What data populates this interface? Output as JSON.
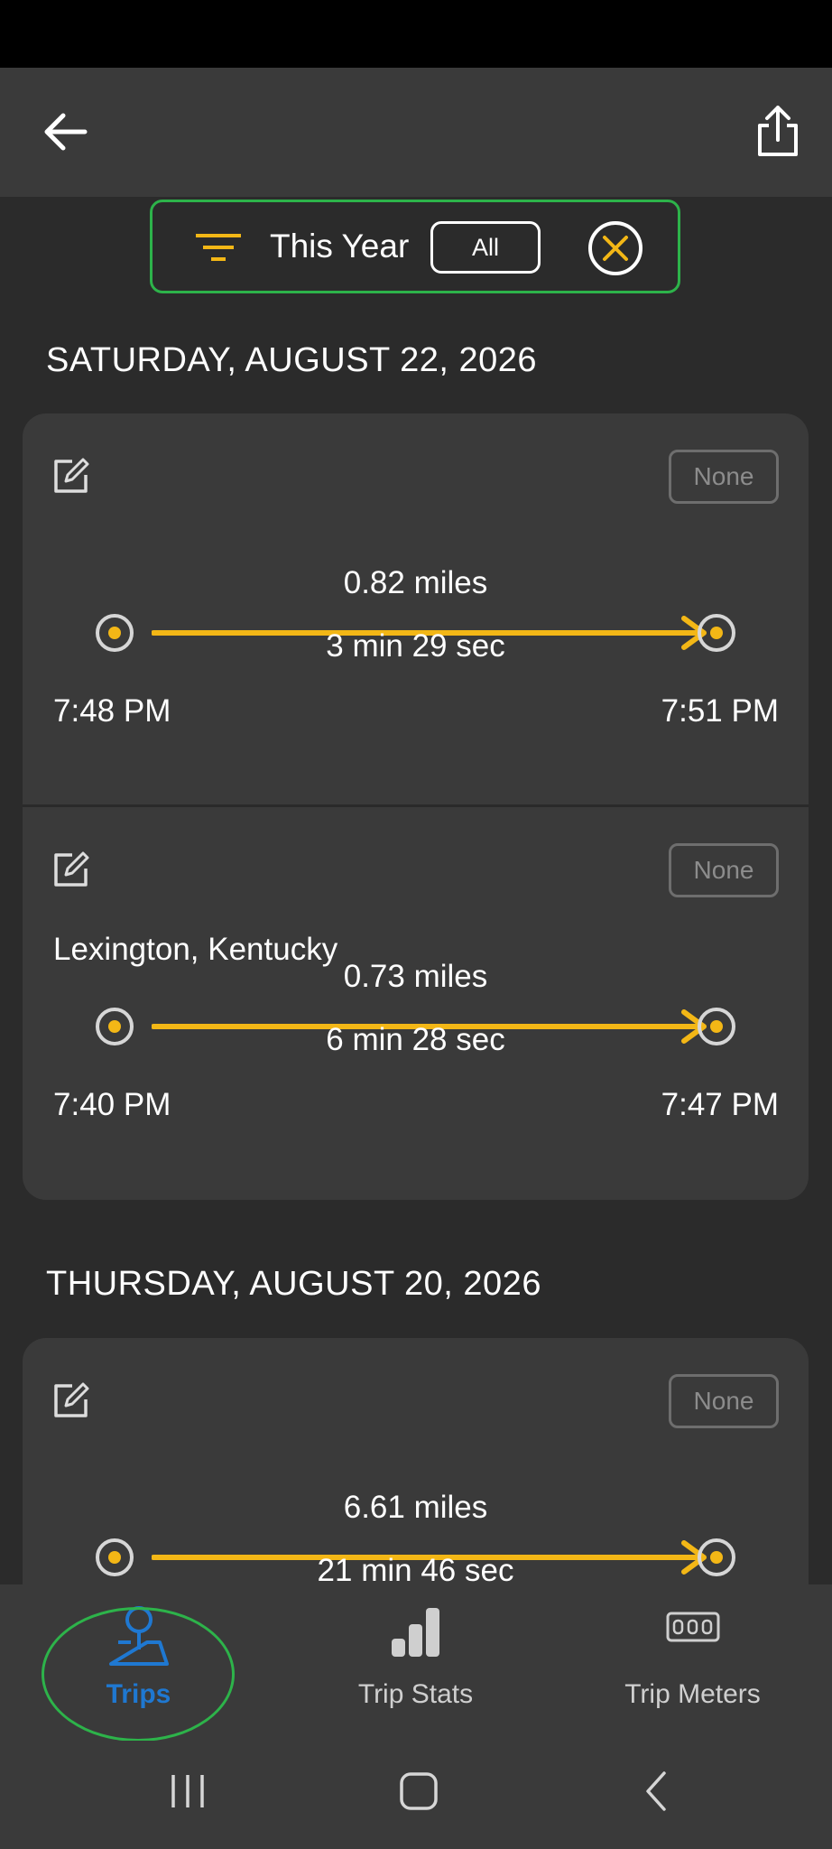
{
  "colors": {
    "accent": "#f3b716",
    "highlight": "#2db34a",
    "active_tab": "#1f78d1"
  },
  "filter": {
    "label": "This Year",
    "all_label": "All"
  },
  "days": [
    {
      "heading": "SATURDAY, AUGUST 22, 2026",
      "trips": [
        {
          "badge": "None",
          "location": "",
          "distance": "0.82 miles",
          "duration": "3 min 29 sec",
          "start": "7:48 PM",
          "end": "7:51 PM"
        },
        {
          "badge": "None",
          "location": "Lexington, Kentucky",
          "distance": "0.73 miles",
          "duration": "6 min 28 sec",
          "start": "7:40 PM",
          "end": "7:47 PM"
        }
      ]
    },
    {
      "heading": "THURSDAY, AUGUST 20, 2026",
      "trips": [
        {
          "badge": "None",
          "location": "",
          "distance": "6.61 miles",
          "duration": "21 min 46 sec",
          "start": "",
          "end": ""
        }
      ]
    }
  ],
  "bottom_nav": [
    {
      "label": "Trips",
      "icon": "map-pin-icon",
      "active": true
    },
    {
      "label": "Trip Stats",
      "icon": "bar-chart-icon",
      "active": false
    },
    {
      "label": "Trip Meters",
      "icon": "odometer-icon",
      "active": false
    }
  ]
}
